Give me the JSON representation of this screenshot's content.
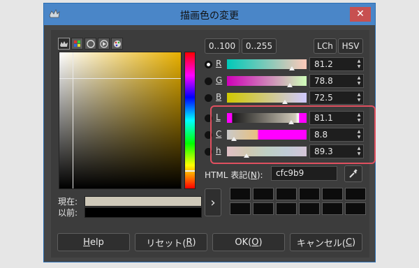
{
  "window": {
    "title": "描画色の変更",
    "close_glyph": "✕"
  },
  "selector_icons": [
    "scales-selector-icon",
    "palette-selector-icon",
    "circle-selector-icon",
    "triangle-selector-icon",
    "watercolor-selector-icon"
  ],
  "range_buttons": {
    "range_100": "0..100",
    "range_255": "0..255"
  },
  "model_buttons": {
    "lch": "LCh",
    "hsv": "HSV"
  },
  "channels": [
    {
      "label": "R",
      "value": "81.2",
      "fraction": 0.812,
      "selected": true
    },
    {
      "label": "G",
      "value": "78.8",
      "fraction": 0.788,
      "selected": false
    },
    {
      "label": "B",
      "value": "72.5",
      "fraction": 0.725,
      "selected": false
    },
    {
      "label": "L",
      "value": "81.1",
      "fraction": 0.811,
      "selected": false
    },
    {
      "label": "C",
      "value": "8.8",
      "fraction": 0.088,
      "selected": false
    },
    {
      "label": "h",
      "value": "89.3",
      "fraction": 0.248,
      "selected": false
    }
  ],
  "html_notation": {
    "label_prefix": "HTML 表記(",
    "mnemonic": "N",
    "label_suffix": "):",
    "value": "cfc9b9"
  },
  "preview": {
    "current_label": "現在:",
    "previous_label": "以前:",
    "current_color": "#cfc9b9",
    "previous_color": "#000000"
  },
  "history_arrow": "›",
  "color_history": [
    "#0c0c0c",
    "#0c0c0c",
    "#0c0c0c",
    "#0c0c0c",
    "#0c0c0c",
    "#0c0c0c",
    "#0c0c0c",
    "#0c0c0c",
    "#0c0c0c",
    "#0c0c0c",
    "#0c0c0c",
    "#0c0c0c"
  ],
  "buttons": {
    "help": {
      "mnemonic": "H",
      "rest": "elp"
    },
    "reset": {
      "prefix": "リセット(",
      "mnemonic": "R",
      "suffix": ")"
    },
    "ok": {
      "prefix": "OK(",
      "mnemonic": "O",
      "suffix": ")"
    },
    "cancel": {
      "prefix": "キャンセル(",
      "mnemonic": "C",
      "suffix": ")"
    }
  },
  "colors": {
    "titlebar": "#4a86c8",
    "close": "#c75050",
    "highlight": "#e05060",
    "hue": "#e8b000"
  }
}
